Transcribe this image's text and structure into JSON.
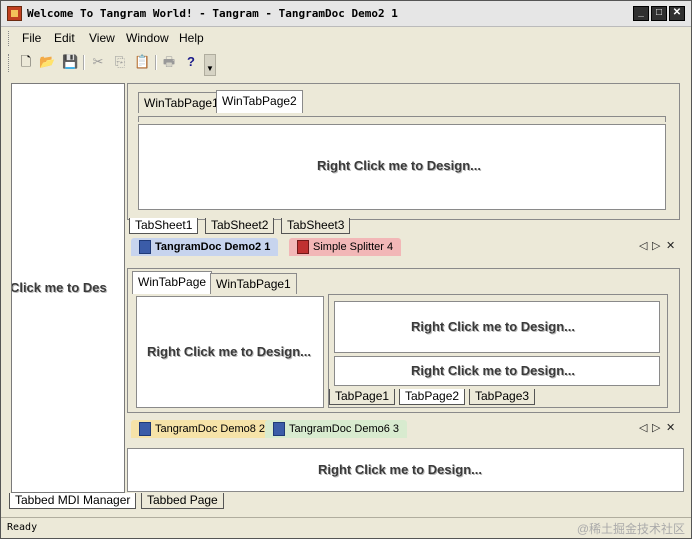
{
  "window": {
    "title": "Welcome To Tangram World! - Tangram - TangramDoc Demo2 1",
    "minimize": "_",
    "maximize": "□",
    "close": "✕"
  },
  "menu": {
    "items": [
      {
        "label": "File",
        "mnemonic": "F"
      },
      {
        "label": "Edit",
        "mnemonic": "E"
      },
      {
        "label": "View",
        "mnemonic": "V"
      },
      {
        "label": "Window",
        "mnemonic": "W"
      },
      {
        "label": "Help",
        "mnemonic": "H"
      }
    ]
  },
  "toolbar": {
    "buttons": [
      {
        "icon": "new-document-icon",
        "glyph": "🗋"
      },
      {
        "icon": "open-folder-icon",
        "glyph": "📂"
      },
      {
        "icon": "save-icon",
        "glyph": "💾"
      },
      {
        "icon": "cut-icon",
        "glyph": "✂"
      },
      {
        "icon": "copy-icon",
        "glyph": "⎘"
      },
      {
        "icon": "paste-icon",
        "glyph": "📋"
      },
      {
        "icon": "print-icon",
        "glyph": "🖶"
      },
      {
        "icon": "help-icon",
        "glyph": "?"
      }
    ]
  },
  "design_hint": "Right Click me to Design...",
  "left_pane_text": "t Click me to Des",
  "top_group": {
    "inner_tabs": [
      "WinTabPage1",
      "WinTabPage2"
    ],
    "active_inner_tab": "WinTabPage2",
    "sheet_tabs": [
      "TabSheet1",
      "TabSheet2",
      "TabSheet3"
    ]
  },
  "doc_strip_top": {
    "tabs": [
      "TangramDoc Demo2 1",
      "Simple Splitter 4"
    ],
    "active": "TangramDoc Demo2 1"
  },
  "bottom_group": {
    "inner_tabs": [
      "WinTabPage",
      "WinTabPage1"
    ],
    "active_inner_tab": "WinTabPage",
    "nested_tabs": [
      "TabPage1",
      "TabPage2",
      "TabPage3"
    ],
    "active_nested": "TabPage2"
  },
  "doc_strip_bottom": {
    "tabs": [
      "TangramDoc Demo8 2",
      "TangramDoc Demo6 3"
    ]
  },
  "strip_controls": {
    "prev": "◁",
    "next": "▷",
    "close": "✕"
  },
  "mdi_tabs": {
    "tabs": [
      "Tabbed MDI Manager",
      "Tabbed Page"
    ],
    "active": "Tabbed MDI Manager"
  },
  "status": {
    "text": "Ready",
    "watermark": "@稀土掘金技术社区"
  },
  "colors": {
    "face": "#ece9d8",
    "active_doc_tab": "#c7d4ee",
    "splitter_doc_tab": "#f2b7b7",
    "yellow_doc_tab": "#f6e3a8",
    "green_doc_tab": "#d8ebcf"
  }
}
